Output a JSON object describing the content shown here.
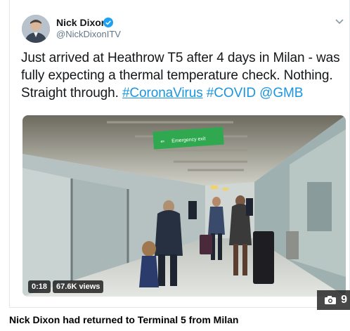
{
  "tweet": {
    "author_name": "Nick Dixon",
    "author_handle": "@NickDixonITV",
    "text_prefix": "Just arrived at Heathrow T5 after 4 days in Milan - was fully expecting a thermal temperature check. Nothing. Straight through. ",
    "hashtag_1": "#CoronaVirus",
    "hashtag_2": "#COVID",
    "mention": "@GMB",
    "video": {
      "sign_text": "Emergency exit",
      "duration": "0:18",
      "views": "67.6K views"
    }
  },
  "gallery": {
    "photo_count": "9",
    "icon": "camera-icon"
  },
  "caption": "Nick Dixon had returned to Terminal 5 from Milan",
  "colors": {
    "link": "#1b95e0",
    "verified": "#1da1f2",
    "sign": "#2fa84f"
  }
}
